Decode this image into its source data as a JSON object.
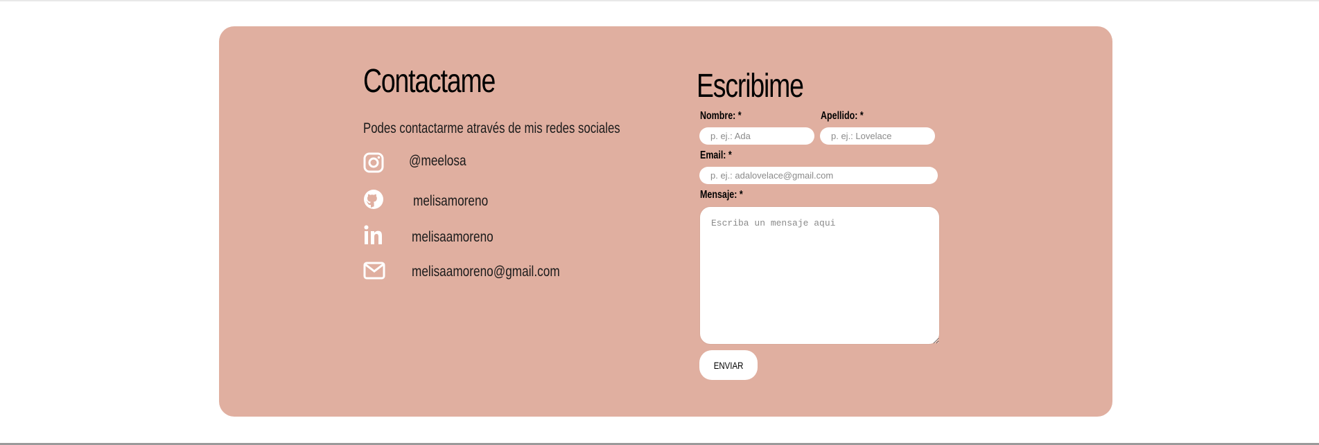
{
  "colors": {
    "card_bg": "#e0afa0",
    "field_bg": "#ffffff"
  },
  "contact": {
    "title": "Contactame",
    "subtitle": "Podes contactarme através de mis redes sociales",
    "socials": [
      {
        "icon": "instagram-icon",
        "handle": "@meelosa"
      },
      {
        "icon": "github-icon",
        "handle": "melisamoreno"
      },
      {
        "icon": "linkedin-icon",
        "handle": "melisaamoreno"
      },
      {
        "icon": "mail-icon",
        "handle": "melisaamoreno@gmail.com"
      }
    ]
  },
  "form": {
    "title": "Escribime",
    "name_label": "Nombre: *",
    "name_placeholder": "p. ej.: Ada",
    "lastname_label": "Apellido: *",
    "lastname_placeholder": "p. ej.: Lovelace",
    "email_label": "Email: *",
    "email_placeholder": "p. ej.: adalovelace@gmail.com",
    "message_label": "Mensaje: *",
    "message_placeholder": "Escriba un mensaje aqui",
    "submit_label": "ENVIAR"
  }
}
